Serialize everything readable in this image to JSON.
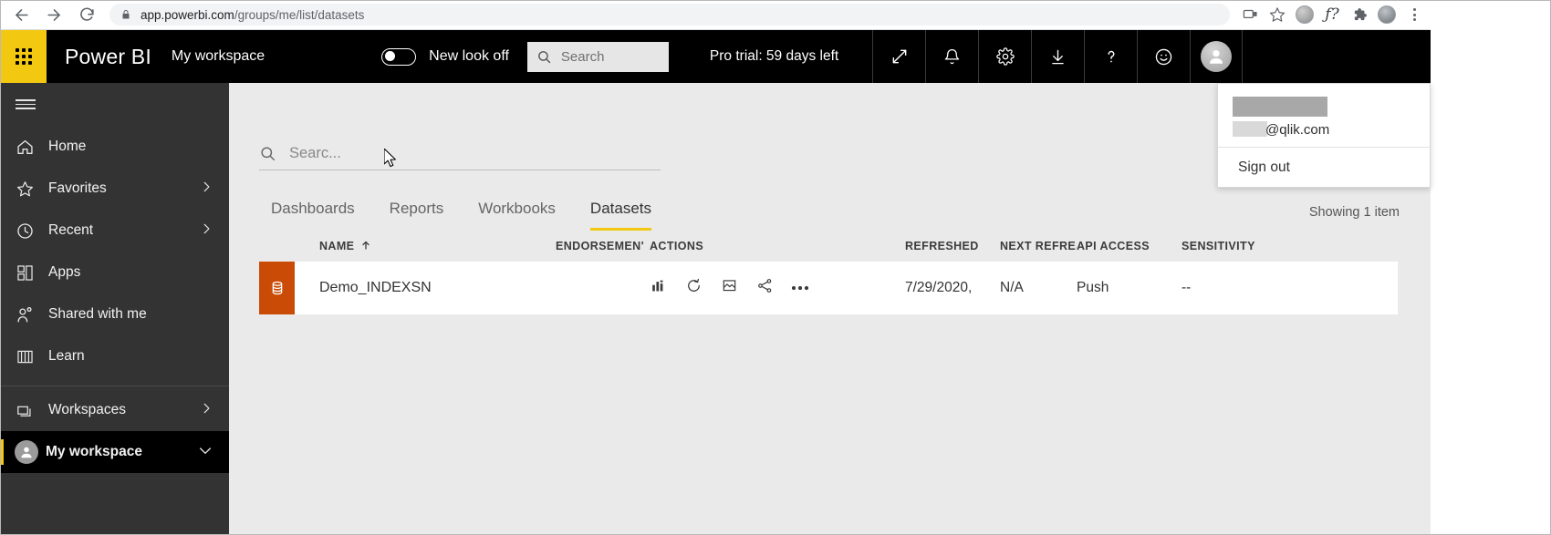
{
  "browser": {
    "back_icon": "back-arrow-icon",
    "forward_icon": "forward-arrow-icon",
    "reload_icon": "reload-icon",
    "lock_icon": "lock-icon",
    "url_domain": "app.powerbi.com",
    "url_path": "/groups/me/list/datasets",
    "actions": [
      {
        "name": "cast-icon",
        "label": ""
      },
      {
        "name": "bookmark-star-icon",
        "label": ""
      },
      {
        "name": "extension-circle-icon",
        "label": ""
      },
      {
        "name": "fx-extension-icon",
        "label": "ƒ?"
      },
      {
        "name": "puzzle-extensions-icon",
        "label": ""
      },
      {
        "name": "profile-avatar-icon",
        "label": ""
      },
      {
        "name": "chrome-menu-icon",
        "label": ""
      }
    ]
  },
  "header": {
    "waffle_icon": "app-launcher-waffle-icon",
    "brand": "Power BI",
    "workspace": "My workspace",
    "toggle_state": "off",
    "toggle_label": "New look off",
    "search_placeholder": "Search",
    "search_icon": "search-icon",
    "pro_trial": "Pro trial: 59 days left",
    "icons": [
      {
        "name": "fullscreen-expand-icon",
        "label": ""
      },
      {
        "name": "notifications-bell-icon",
        "label": ""
      },
      {
        "name": "settings-gear-icon",
        "label": ""
      },
      {
        "name": "download-icon",
        "label": ""
      },
      {
        "name": "help-question-icon",
        "label": ""
      },
      {
        "name": "feedback-smiley-icon",
        "label": ""
      },
      {
        "name": "account-avatar-icon",
        "label": ""
      }
    ]
  },
  "sidebar": {
    "hamburger_icon": "hamburger-menu-icon",
    "items": [
      {
        "label": "Home",
        "icon": "home-icon",
        "chevron": false
      },
      {
        "label": "Favorites",
        "icon": "star-icon",
        "chevron": true
      },
      {
        "label": "Recent",
        "icon": "clock-icon",
        "chevron": true
      },
      {
        "label": "Apps",
        "icon": "apps-grid-icon",
        "chevron": false
      },
      {
        "label": "Shared with me",
        "icon": "person-share-icon",
        "chevron": false
      },
      {
        "label": "Learn",
        "icon": "book-icon",
        "chevron": false
      }
    ],
    "workspaces": {
      "label": "Workspaces",
      "icon": "workspaces-stack-icon",
      "chevron": true
    },
    "active_workspace": {
      "label": "My workspace",
      "icon": "workspace-avatar-icon",
      "chevron": true
    }
  },
  "main": {
    "search_placeholder": "Searc...",
    "search_icon": "search-icon",
    "tabs": [
      {
        "label": "Dashboards",
        "active": false
      },
      {
        "label": "Reports",
        "active": false
      },
      {
        "label": "Workbooks",
        "active": false
      },
      {
        "label": "Datasets",
        "active": true
      }
    ],
    "showing": "Showing 1 item",
    "columns": [
      "NAME",
      "ENDORSEMEN'",
      "ACTIONS",
      "REFRESHED",
      "NEXT REFRESI",
      "API ACCESS",
      "SENSITIVITY"
    ],
    "sort": {
      "column": "NAME",
      "direction": "asc",
      "icon": "sort-arrow-up-icon"
    },
    "rows": [
      {
        "icon": "dataset-icon",
        "icon_color": "#ca4b06",
        "name": "Demo_INDEXSN",
        "endorsement": "",
        "actions": [
          "create-report-chart-icon",
          "refresh-now-icon",
          "analyze-in-excel-icon",
          "share-icon",
          "more-options-icon"
        ],
        "refreshed": "7/29/2020,",
        "next_refresh": "N/A",
        "api_access": "Push",
        "sensitivity": "--"
      }
    ]
  },
  "account_menu": {
    "name_redacted": "",
    "email": "@qlik.com",
    "sign_out": "Sign out"
  },
  "colors": {
    "brand_yellow": "#f2c811",
    "header_black": "#000000",
    "sidebar": "#333333",
    "dataset_orange": "#ca4b06"
  }
}
